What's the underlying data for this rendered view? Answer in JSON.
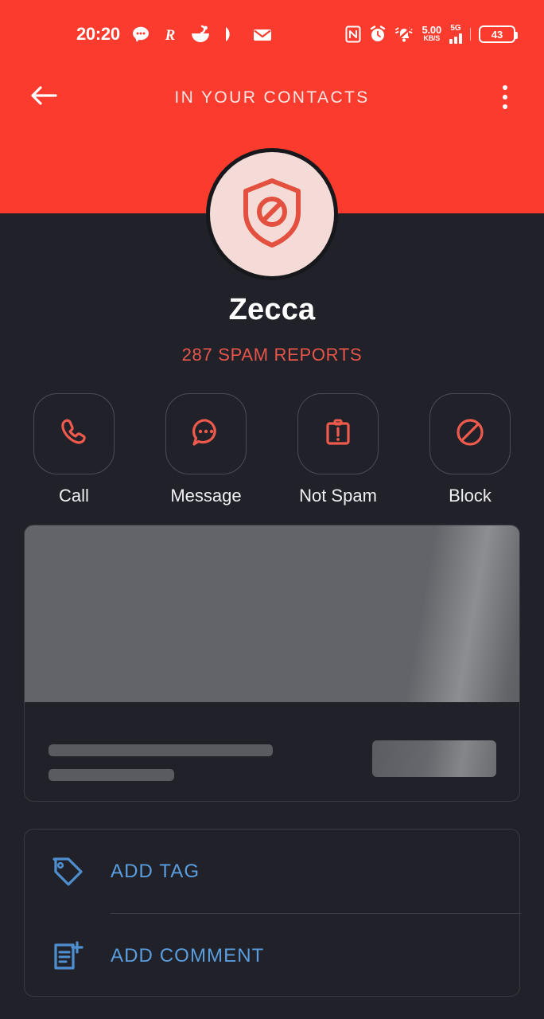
{
  "theme": {
    "header_red": "#FB3B2E",
    "background_dark": "#212229",
    "accent_red": "#E8554A",
    "link_blue": "#5A9EE0",
    "avatar_bg": "#F4DBD7",
    "border_gray": "#393A41"
  },
  "status_bar": {
    "time": "20:20",
    "left_icons": [
      "chat-bubble-icon",
      "r-app-icon",
      "bowl-icon",
      "pick-icon",
      "envelope-icon"
    ],
    "right": {
      "nfc_icon": "nfc-icon",
      "alarm_icon": "alarm-icon",
      "mute_icon": "bell-mute-icon",
      "net_speed_value": "5.00",
      "net_speed_unit": "KB/S",
      "network_type": "5G",
      "signal_icon": "signal-bars-icon",
      "battery_level": "43"
    }
  },
  "app_bar": {
    "back_icon": "back-arrow-icon",
    "title": "IN YOUR CONTACTS",
    "overflow_icon": "more-vertical-icon"
  },
  "profile": {
    "avatar_icon": "shield-block-icon",
    "name": "Zecca",
    "spam_reports": "287 SPAM REPORTS"
  },
  "actions": [
    {
      "label": "Call",
      "icon": "phone-icon"
    },
    {
      "label": "Message",
      "icon": "message-bubble-icon"
    },
    {
      "label": "Not Spam",
      "icon": "clipboard-alert-icon"
    },
    {
      "label": "Block",
      "icon": "block-circle-icon"
    }
  ],
  "skeleton_card": {
    "state": "loading-placeholder"
  },
  "tag_comment_card": {
    "rows": [
      {
        "label": "ADD TAG",
        "icon": "tag-icon"
      },
      {
        "label": "ADD COMMENT",
        "icon": "comment-add-icon"
      }
    ]
  }
}
